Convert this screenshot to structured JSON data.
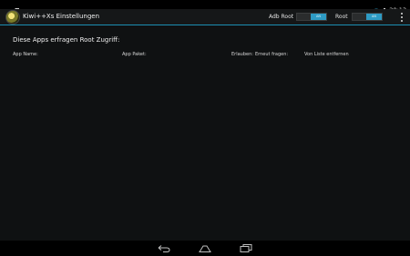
{
  "status_bar": {
    "time": "20:13",
    "icons": [
      "screenshot-icon",
      "sd-card-icon",
      "wifi-icon",
      "battery-icon"
    ]
  },
  "action_bar": {
    "title": "Kiwi++Xs Einstellungen",
    "toggles": [
      {
        "label": "Adb Root",
        "state": "AN"
      },
      {
        "label": "Root",
        "state": "AN"
      }
    ],
    "menu_icon": "overflow-menu-icon"
  },
  "main": {
    "heading": "Diese Apps erfragen Root Zugriff:",
    "columns": [
      "App Name:",
      "App Paket:",
      "Erlauben:",
      "Erneut fragen:",
      "Von Liste entfernen"
    ]
  },
  "nav_bar": {
    "buttons": [
      "back-icon",
      "home-icon",
      "recent-apps-icon"
    ]
  },
  "colors": {
    "accent": "#2e9bc4",
    "background": "#0f1112",
    "bar": "#000000"
  }
}
